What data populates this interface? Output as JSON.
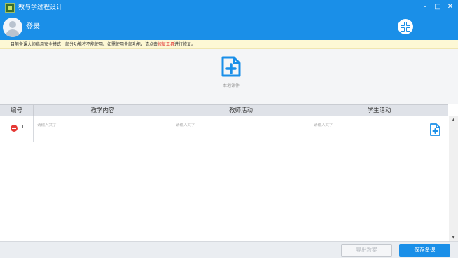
{
  "window": {
    "title": "教与学过程设计",
    "minimize": "–",
    "maximize": "□",
    "close": "✕"
  },
  "header": {
    "login_label": "登录",
    "grid_icon": "grid-icon"
  },
  "notice": {
    "text_before": "目前备课大师启用安全模式，部分功能将不能使用。如需使用全部功能，请点击",
    "link": "修复工具",
    "text_after": "进行修复。"
  },
  "import": {
    "label": "本地课件",
    "icon": "import-file-icon"
  },
  "table": {
    "columns": [
      "编号",
      "教学内容",
      "教师活动",
      "学生活动"
    ],
    "rows": [
      {
        "number": "1",
        "teaching_content_placeholder": "请输入文字",
        "teacher_activity_placeholder": "请输入文字",
        "student_activity_placeholder": "请输入文字"
      }
    ]
  },
  "footer": {
    "export_label": "导出教案",
    "save_label": "保存备课"
  },
  "colors": {
    "primary": "#1a8fe8",
    "notice_bg": "#fdf8d5",
    "notice_link": "#e03030",
    "delete": "#e53935"
  }
}
